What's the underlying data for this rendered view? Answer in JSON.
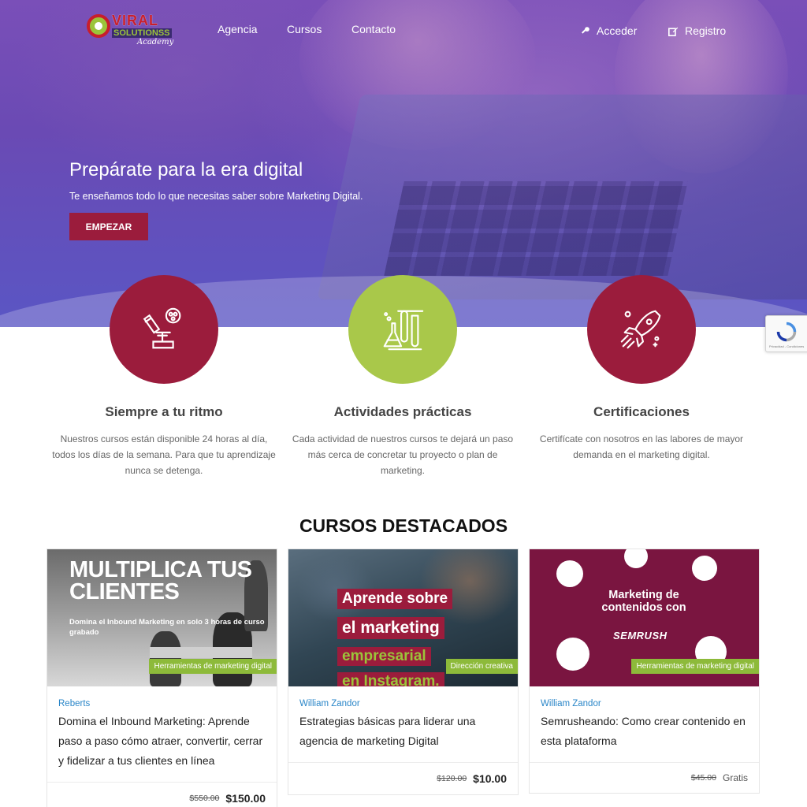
{
  "nav": {
    "logo_word1": "VIRAL",
    "logo_word2": "SOLUTIONSS",
    "logo_word3": "Academy",
    "links": [
      "Agencia",
      "Cursos",
      "Contacto"
    ],
    "login": "Acceder",
    "register": "Registro"
  },
  "hero": {
    "title": "Prepárate para la era digital",
    "subtitle": "Te enseñamos todo lo que necesitas saber sobre Marketing Digital.",
    "button": "EMPEZAR"
  },
  "features": [
    {
      "icon": "microscope-icon",
      "color": "#9b1c3c",
      "title": "Siempre a tu ritmo",
      "text": "Nuestros cursos están disponible 24 horas al día, todos los días de la semana. Para que tu aprendizaje nunca se detenga."
    },
    {
      "icon": "lab-flasks-icon",
      "color": "#a9c84a",
      "title": "Actividades prácticas",
      "text": "Cada actividad de nuestros cursos te dejará un paso más cerca de concretar tu proyecto o plan de marketing."
    },
    {
      "icon": "rocket-icon",
      "color": "#9b1c3c",
      "title": "Certificaciones",
      "text": "Certifícate con nosotros en las labores de mayor demanda en el marketing digital."
    }
  ],
  "recaptcha": {
    "text": "Privacidad - Condiciones"
  },
  "courses_section": {
    "title": "CURSOS DESTACADOS"
  },
  "courses": [
    {
      "image_text_1": "MULTIPLICA TUS CLIENTES",
      "image_text_2": "Domina el Inbound Marketing en solo 3 horas de curso grabado",
      "tag": "Herramientas de marketing digital",
      "author": "Reberts",
      "title": "Domina el Inbound Marketing: Aprende paso a paso cómo atraer, convertir, cerrar y fidelizar a tus clientes en línea",
      "price_old": "$550.00",
      "price_new": "$150.00"
    },
    {
      "image_lines": [
        "Aprende sobre",
        "el marketing",
        "empresarial",
        "en Instagram."
      ],
      "tag": "Dirección creativa",
      "author": "William Zandor",
      "title": "Estrategias básicas para liderar una agencia de marketing Digital",
      "price_old": "$120.00",
      "price_new": "$10.00"
    },
    {
      "image_text_1": "Marketing de contenidos con",
      "image_text_2": "SEMRUSH",
      "tag": "Herramientas de marketing digital",
      "author": "William Zandor",
      "title": "Semrusheando: Como crear contenido en esta plataforma",
      "price_old": "$45.00",
      "price_new": "Gratis"
    }
  ]
}
